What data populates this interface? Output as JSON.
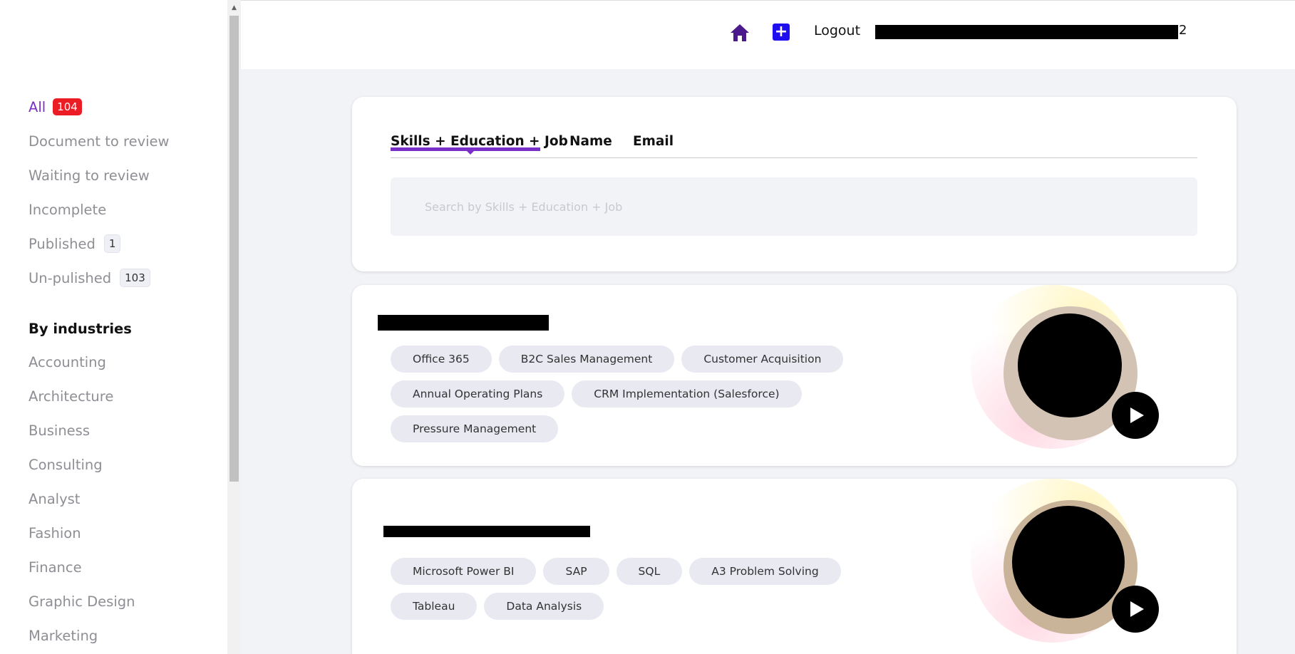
{
  "sidebar": {
    "filters": [
      {
        "label": "All",
        "count": "104"
      },
      {
        "label": "Document to review",
        "count": ""
      },
      {
        "label": "Waiting to review",
        "count": ""
      },
      {
        "label": "Incomplete",
        "count": ""
      },
      {
        "label": "Published",
        "count": "1"
      },
      {
        "label": "Un-pulished",
        "count": "103"
      }
    ],
    "industries_title": "By industries",
    "industries": [
      "Accounting",
      "Architecture",
      "Business",
      "Consulting",
      "Analyst",
      "Fashion",
      "Finance",
      "Graphic Design",
      "Marketing"
    ]
  },
  "header": {
    "home_icon": "home-icon",
    "add_icon": "plus-icon",
    "logout_label": "Logout",
    "user_tail": "2"
  },
  "search": {
    "tabs": [
      "Skills + Education + Job",
      "Name",
      "Email"
    ],
    "active_tab": "Skills + Education + Job",
    "placeholder": "Search by Skills + Education + Job",
    "value": ""
  },
  "profiles": [
    {
      "name": "",
      "tags": [
        "Office 365",
        "B2C Sales Management",
        "Customer Acquisition",
        "Annual Operating Plans",
        "CRM Implementation (Salesforce)",
        "Pressure Management"
      ]
    },
    {
      "name": "",
      "tags": [
        "Microsoft Power BI",
        "SAP",
        "SQL",
        "A3 Problem Solving",
        "Tableau",
        "Data Analysis"
      ]
    }
  ],
  "colors": {
    "accent": "#7b2fc9",
    "badge_red": "#ec1c24",
    "plus_blue": "#1e0ef0",
    "home_purple": "#4a1a8c",
    "tag_bg": "#e8e9f1",
    "page_bg": "#f2f3f7"
  }
}
